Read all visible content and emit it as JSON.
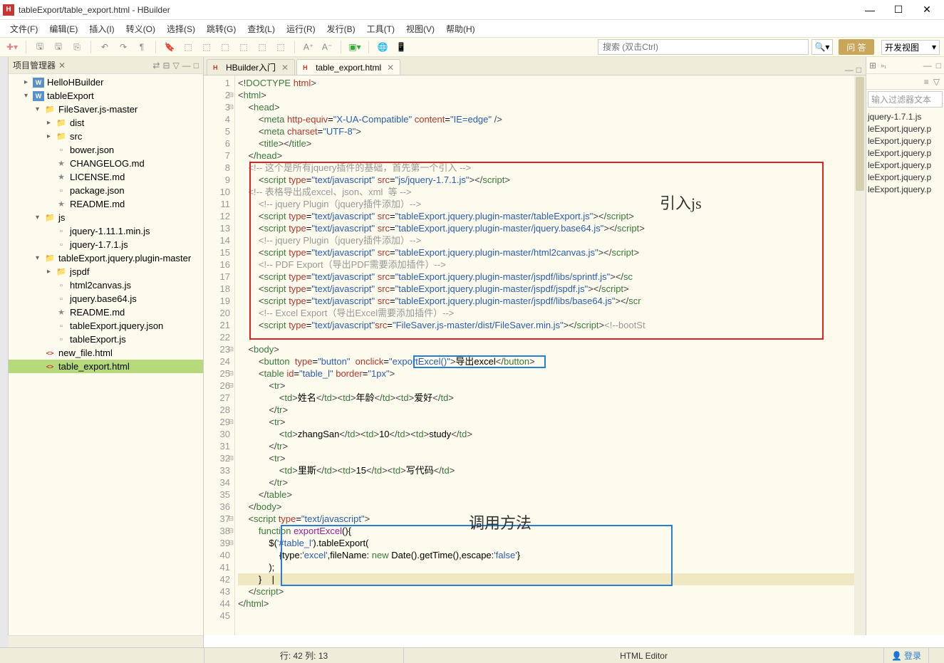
{
  "title": "tableExport/table_export.html - HBuilder",
  "menu": [
    "文件(F)",
    "编辑(E)",
    "插入(I)",
    "转义(O)",
    "选择(S)",
    "跳转(G)",
    "查找(L)",
    "运行(R)",
    "发行(B)",
    "工具(T)",
    "视图(V)",
    "帮助(H)"
  ],
  "search_placeholder": "搜索 (双击Ctrl)",
  "qa": "问 答",
  "view_select": "开发视图",
  "panel_title": "项目管理器",
  "tree": [
    {
      "d": 1,
      "a": ">",
      "i": "word",
      "t": "HelloHBuilder"
    },
    {
      "d": 1,
      "a": "v",
      "i": "word",
      "t": "tableExport"
    },
    {
      "d": 2,
      "a": "v",
      "i": "folder",
      "t": "FileSaver.js-master"
    },
    {
      "d": 3,
      "a": ">",
      "i": "folder",
      "t": "dist"
    },
    {
      "d": 3,
      "a": ">",
      "i": "folder",
      "t": "src"
    },
    {
      "d": 3,
      "a": "",
      "i": "file",
      "t": "bower.json"
    },
    {
      "d": 3,
      "a": "",
      "i": "star",
      "t": "CHANGELOG.md"
    },
    {
      "d": 3,
      "a": "",
      "i": "star",
      "t": "LICENSE.md"
    },
    {
      "d": 3,
      "a": "",
      "i": "file",
      "t": "package.json"
    },
    {
      "d": 3,
      "a": "",
      "i": "star",
      "t": "README.md"
    },
    {
      "d": 2,
      "a": "v",
      "i": "folder",
      "t": "js"
    },
    {
      "d": 3,
      "a": "",
      "i": "file",
      "t": "jquery-1.11.1.min.js"
    },
    {
      "d": 3,
      "a": "",
      "i": "file",
      "t": "jquery-1.7.1.js"
    },
    {
      "d": 2,
      "a": "v",
      "i": "folder",
      "t": "tableExport.jquery.plugin-master"
    },
    {
      "d": 3,
      "a": ">",
      "i": "folder",
      "t": "jspdf"
    },
    {
      "d": 3,
      "a": "",
      "i": "file",
      "t": "html2canvas.js"
    },
    {
      "d": 3,
      "a": "",
      "i": "file",
      "t": "jquery.base64.js"
    },
    {
      "d": 3,
      "a": "",
      "i": "star",
      "t": "README.md"
    },
    {
      "d": 3,
      "a": "",
      "i": "file",
      "t": "tableExport.jquery.json"
    },
    {
      "d": 3,
      "a": "",
      "i": "file",
      "t": "tableExport.js"
    },
    {
      "d": 2,
      "a": "",
      "i": "html",
      "t": "new_file.html"
    },
    {
      "d": 2,
      "a": "",
      "i": "html",
      "t": "table_export.html",
      "sel": true
    }
  ],
  "tabs": [
    {
      "label": "HBuilder入门",
      "active": false
    },
    {
      "label": "table_export.html",
      "active": true
    }
  ],
  "right_filter": "输入过滤器文本",
  "right_items": [
    "jquery-1.7.1.js",
    "leExport.jquery.p",
    "leExport.jquery.p",
    "leExport.jquery.p",
    "leExport.jquery.p",
    "leExport.jquery.p",
    "leExport.jquery.p"
  ],
  "status": {
    "pos": "行: 42  列: 13",
    "mode": "HTML Editor",
    "login": "登录"
  },
  "annotations": {
    "label1": "引入js",
    "label2": "调用方法"
  },
  "code": {
    "lines": [
      {
        "n": 1,
        "fold": "",
        "html": "<span class='delim'>&lt;!</span><span class='tag'>DOCTYPE</span> <span class='attr'>html</span><span class='delim'>&gt;</span>"
      },
      {
        "n": 2,
        "fold": "⊟",
        "html": "<span class='delim'>&lt;</span><span class='tag'>html</span><span class='delim'>&gt;</span>"
      },
      {
        "n": 3,
        "fold": "⊟",
        "html": "    <span class='delim'>&lt;</span><span class='tag'>head</span><span class='delim'>&gt;</span>"
      },
      {
        "n": 4,
        "fold": "",
        "html": "        <span class='delim'>&lt;</span><span class='tag'>meta</span> <span class='attr'>http-equiv</span>=<span class='str'>\"X-UA-Compatible\"</span> <span class='attr'>content</span>=<span class='str'>\"IE=edge\"</span> <span class='delim'>/&gt;</span>"
      },
      {
        "n": 5,
        "fold": "",
        "html": "        <span class='delim'>&lt;</span><span class='tag'>meta</span> <span class='attr'>charset</span>=<span class='str'>\"UTF-8\"</span><span class='delim'>&gt;</span>"
      },
      {
        "n": 6,
        "fold": "",
        "html": "        <span class='delim'>&lt;</span><span class='tag'>title</span><span class='delim'>&gt;&lt;/</span><span class='tag'>title</span><span class='delim'>&gt;</span>"
      },
      {
        "n": 7,
        "fold": "",
        "html": "    <span class='delim'>&lt;/</span><span class='tag'>head</span><span class='delim'>&gt;</span>"
      },
      {
        "n": 8,
        "fold": "",
        "html": "    <span class='cmt'>&lt;!-- 这个是所有jquery插件的基础，首先第一个引入 --&gt;</span>"
      },
      {
        "n": 9,
        "fold": "",
        "html": "        <span class='delim'>&lt;</span><span class='tag'>script</span> <span class='attr'>type</span>=<span class='str'>\"text/javascript\"</span> <span class='attr'>src</span>=<span class='str'>\"js/jquery-1.7.1.js\"</span><span class='delim'>&gt;&lt;/</span><span class='tag'>script</span><span class='delim'>&gt;</span>"
      },
      {
        "n": 10,
        "fold": "",
        "html": "    <span class='cmt'>&lt;!-- 表格导出成excel、json、xml  等 --&gt;</span>"
      },
      {
        "n": 11,
        "fold": "",
        "html": "        <span class='cmt'>&lt;!-- jquery Plugin（jquery插件添加）--&gt;</span>"
      },
      {
        "n": 12,
        "fold": "",
        "html": "        <span class='delim'>&lt;</span><span class='tag'>script</span> <span class='attr'>type</span>=<span class='str'>\"text/javascript\"</span> <span class='attr'>src</span>=<span class='str'>\"tableExport.jquery.plugin-master/tableExport.js\"</span><span class='delim'>&gt;&lt;/</span><span class='tag'>script</span><span class='delim'>&gt;</span>"
      },
      {
        "n": 13,
        "fold": "",
        "html": "        <span class='delim'>&lt;</span><span class='tag'>script</span> <span class='attr'>type</span>=<span class='str'>\"text/javascript\"</span> <span class='attr'>src</span>=<span class='str'>\"tableExport.jquery.plugin-master/jquery.base64.js\"</span><span class='delim'>&gt;&lt;/</span><span class='tag'>script</span><span class='delim'>&gt;</span>"
      },
      {
        "n": 14,
        "fold": "",
        "html": "        <span class='cmt'>&lt;!-- jquery Plugin（jquery插件添加）--&gt;</span>"
      },
      {
        "n": 15,
        "fold": "",
        "html": "        <span class='delim'>&lt;</span><span class='tag'>script</span> <span class='attr'>type</span>=<span class='str'>\"text/javascript\"</span> <span class='attr'>src</span>=<span class='str'>\"tableExport.jquery.plugin-master/html2canvas.js\"</span><span class='delim'>&gt;&lt;/</span><span class='tag'>script</span><span class='delim'>&gt;</span>"
      },
      {
        "n": 16,
        "fold": "",
        "html": "        <span class='cmt'>&lt;!-- PDF Export（导出PDF需要添加插件）--&gt;</span>"
      },
      {
        "n": 17,
        "fold": "",
        "html": "        <span class='delim'>&lt;</span><span class='tag'>script</span> <span class='attr'>type</span>=<span class='str'>\"text/javascript\"</span> <span class='attr'>src</span>=<span class='str'>\"tableExport.jquery.plugin-master/jspdf/libs/sprintf.js\"</span><span class='delim'>&gt;&lt;/</span><span class='tag'>sc</span>"
      },
      {
        "n": 18,
        "fold": "",
        "html": "        <span class='delim'>&lt;</span><span class='tag'>script</span> <span class='attr'>type</span>=<span class='str'>\"text/javascript\"</span> <span class='attr'>src</span>=<span class='str'>\"tableExport.jquery.plugin-master/jspdf/jspdf.js\"</span><span class='delim'>&gt;&lt;/</span><span class='tag'>script</span><span class='delim'>&gt;</span>"
      },
      {
        "n": 19,
        "fold": "",
        "html": "        <span class='delim'>&lt;</span><span class='tag'>script</span> <span class='attr'>type</span>=<span class='str'>\"text/javascript\"</span> <span class='attr'>src</span>=<span class='str'>\"tableExport.jquery.plugin-master/jspdf/libs/base64.js\"</span><span class='delim'>&gt;&lt;/</span><span class='tag'>scr</span>"
      },
      {
        "n": 20,
        "fold": "",
        "html": "        <span class='cmt'>&lt;!-- Excel Export（导出Excel需要添加插件）--&gt;</span>"
      },
      {
        "n": 21,
        "fold": "",
        "html": "        <span class='delim'>&lt;</span><span class='tag'>script</span> <span class='attr'>type</span>=<span class='str'>\"text/javascript\"</span><span class='attr'>src</span>=<span class='str'>\"FileSaver.js-master/dist/FileSaver.min.js\"</span><span class='delim'>&gt;&lt;/</span><span class='tag'>script</span><span class='delim'>&gt;</span><span class='cmt'>&lt;!--bootSt</span>"
      },
      {
        "n": 22,
        "fold": "",
        "html": ""
      },
      {
        "n": 23,
        "fold": "⊟",
        "html": "    <span class='delim'>&lt;</span><span class='tag'>body</span><span class='delim'>&gt;</span>"
      },
      {
        "n": 24,
        "fold": "",
        "html": "        <span class='delim'>&lt;</span><span class='tag'>button</span>  <span class='attr'>type</span>=<span class='str'>\"button\"</span>  <span class='attr'>onclick</span>=<span class='str'>\"exportExcel()\"</span><span class='delim'>&gt;</span>导出excel<span class='delim'>&lt;/</span><span class='tag'>button</span><span class='delim'>&gt;</span>"
      },
      {
        "n": 25,
        "fold": "⊟",
        "html": "        <span class='delim'>&lt;</span><span class='tag'>table</span> <span class='attr'>id</span>=<span class='str'>\"table_l\"</span> <span class='attr'>border</span>=<span class='str'>\"1px\"</span><span class='delim'>&gt;</span>"
      },
      {
        "n": 26,
        "fold": "⊟",
        "html": "            <span class='delim'>&lt;</span><span class='tag'>tr</span><span class='delim'>&gt;</span>"
      },
      {
        "n": 27,
        "fold": "",
        "html": "                <span class='delim'>&lt;</span><span class='tag'>td</span><span class='delim'>&gt;</span>姓名<span class='delim'>&lt;/</span><span class='tag'>td</span><span class='delim'>&gt;&lt;</span><span class='tag'>td</span><span class='delim'>&gt;</span>年龄<span class='delim'>&lt;/</span><span class='tag'>td</span><span class='delim'>&gt;&lt;</span><span class='tag'>td</span><span class='delim'>&gt;</span>爱好<span class='delim'>&lt;/</span><span class='tag'>td</span><span class='delim'>&gt;</span>"
      },
      {
        "n": 28,
        "fold": "",
        "html": "            <span class='delim'>&lt;/</span><span class='tag'>tr</span><span class='delim'>&gt;</span>"
      },
      {
        "n": 29,
        "fold": "⊟",
        "html": "            <span class='delim'>&lt;</span><span class='tag'>tr</span><span class='delim'>&gt;</span>"
      },
      {
        "n": 30,
        "fold": "",
        "html": "                <span class='delim'>&lt;</span><span class='tag'>td</span><span class='delim'>&gt;</span>zhangSan<span class='delim'>&lt;/</span><span class='tag'>td</span><span class='delim'>&gt;&lt;</span><span class='tag'>td</span><span class='delim'>&gt;</span>10<span class='delim'>&lt;/</span><span class='tag'>td</span><span class='delim'>&gt;&lt;</span><span class='tag'>td</span><span class='delim'>&gt;</span>study<span class='delim'>&lt;/</span><span class='tag'>td</span><span class='delim'>&gt;</span>"
      },
      {
        "n": 31,
        "fold": "",
        "html": "            <span class='delim'>&lt;/</span><span class='tag'>tr</span><span class='delim'>&gt;</span>"
      },
      {
        "n": 32,
        "fold": "⊟",
        "html": "            <span class='delim'>&lt;</span><span class='tag'>tr</span><span class='delim'>&gt;</span>"
      },
      {
        "n": 33,
        "fold": "",
        "html": "                <span class='delim'>&lt;</span><span class='tag'>td</span><span class='delim'>&gt;</span>里斯<span class='delim'>&lt;/</span><span class='tag'>td</span><span class='delim'>&gt;&lt;</span><span class='tag'>td</span><span class='delim'>&gt;</span>15<span class='delim'>&lt;/</span><span class='tag'>td</span><span class='delim'>&gt;&lt;</span><span class='tag'>td</span><span class='delim'>&gt;</span>写代码<span class='delim'>&lt;/</span><span class='tag'>td</span><span class='delim'>&gt;</span>"
      },
      {
        "n": 34,
        "fold": "",
        "html": "            <span class='delim'>&lt;/</span><span class='tag'>tr</span><span class='delim'>&gt;</span>"
      },
      {
        "n": 35,
        "fold": "",
        "html": "        <span class='delim'>&lt;/</span><span class='tag'>table</span><span class='delim'>&gt;</span>"
      },
      {
        "n": 36,
        "fold": "",
        "html": "    <span class='delim'>&lt;/</span><span class='tag'>body</span><span class='delim'>&gt;</span>"
      },
      {
        "n": 37,
        "fold": "⊟",
        "html": "    <span class='delim'>&lt;</span><span class='tag'>script</span> <span class='attr'>type</span>=<span class='str'>\"text/javascript\"</span><span class='delim'>&gt;</span>"
      },
      {
        "n": 38,
        "fold": "⊟",
        "html": "        <span class='kw'>function</span> <span class='fn'>exportExcel</span>(){"
      },
      {
        "n": 39,
        "fold": "⊟",
        "html": "            $(<span class='str'>'#table_l'</span>).tableExport("
      },
      {
        "n": 40,
        "fold": "",
        "html": "                {type:<span class='str'>'excel'</span>,fileName: <span class='kw'>new</span> Date().getTime(),escape:<span class='str'>'false'</span>}"
      },
      {
        "n": 41,
        "fold": "",
        "html": "            );"
      },
      {
        "n": 42,
        "fold": "",
        "html": "        }    |",
        "cursor": true
      },
      {
        "n": 43,
        "fold": "",
        "html": "    <span class='delim'>&lt;/</span><span class='tag'>script</span><span class='delim'>&gt;</span>"
      },
      {
        "n": 44,
        "fold": "",
        "html": "<span class='delim'>&lt;/</span><span class='tag'>html</span><span class='delim'>&gt;</span>"
      },
      {
        "n": 45,
        "fold": "",
        "html": ""
      }
    ]
  }
}
